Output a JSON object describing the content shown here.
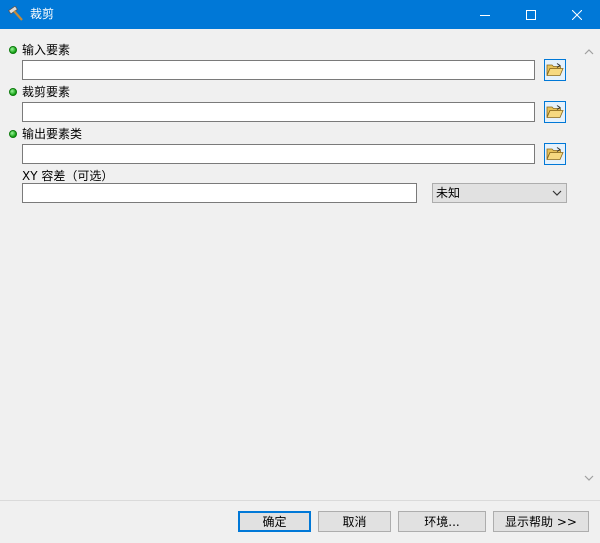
{
  "window": {
    "title": "裁剪",
    "title_bar_color": "#0078d7"
  },
  "params": [
    {
      "label": "输入要素",
      "value": "",
      "required": true
    },
    {
      "label": "裁剪要素",
      "value": "",
      "required": true
    },
    {
      "label": "输出要素类",
      "value": "",
      "required": true
    }
  ],
  "xy_tolerance": {
    "label": "XY 容差（可选）",
    "value": "",
    "unit_selected": "未知"
  },
  "icons": {
    "title": "hammer-icon",
    "browse": "folder-open-icon",
    "required": "green-dot-icon"
  },
  "buttons": {
    "ok": "确定",
    "cancel": "取消",
    "environments": "环境...",
    "show_help": "显示帮助 >>"
  }
}
